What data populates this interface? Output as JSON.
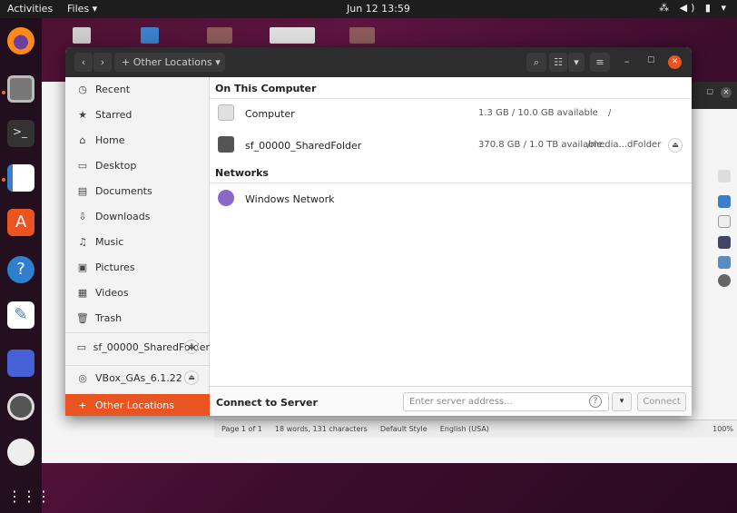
{
  "topbar": {
    "activities": "Activities",
    "app_menu": "Files ▾",
    "clock": "Jun 12  13:59",
    "tray": "⁂ ◀) ▮ ▾"
  },
  "files_window": {
    "location_button": "Other Locations",
    "sidebar": [
      {
        "icon": "recent-icon",
        "glyph": "◷",
        "label": "Recent"
      },
      {
        "icon": "star-icon",
        "glyph": "★",
        "label": "Starred"
      },
      {
        "icon": "home-icon",
        "glyph": "⌂",
        "label": "Home"
      },
      {
        "icon": "desktop-icon",
        "glyph": "▭",
        "label": "Desktop"
      },
      {
        "icon": "documents-icon",
        "glyph": "▤",
        "label": "Documents"
      },
      {
        "icon": "downloads-icon",
        "glyph": "⇩",
        "label": "Downloads"
      },
      {
        "icon": "music-icon",
        "glyph": "♫",
        "label": "Music"
      },
      {
        "icon": "pictures-icon",
        "glyph": "▣",
        "label": "Pictures"
      },
      {
        "icon": "videos-icon",
        "glyph": "▦",
        "label": "Videos"
      },
      {
        "icon": "trash-icon",
        "glyph": "🗑",
        "label": "Trash"
      }
    ],
    "devices": [
      {
        "label": "sf_00000_SharedFolder"
      },
      {
        "label": "VBox_GAs_6.1.22"
      }
    ],
    "other_locations": "Other Locations",
    "sections": {
      "on_this_computer": "On This Computer",
      "networks": "Networks"
    },
    "locations": [
      {
        "name": "Computer",
        "size": "1.3 GB / 10.0 GB available",
        "path": "/"
      },
      {
        "name": "sf_00000_SharedFolder",
        "size": "370.8 GB / 1.0 TB available",
        "path": "/media...dFolder"
      }
    ],
    "networks": [
      {
        "name": "Windows Network"
      }
    ],
    "connect": {
      "label": "Connect to Server",
      "placeholder": "Enter server address...",
      "button": "Connect"
    }
  },
  "background_writer": {
    "status": {
      "page": "Page 1 of 1",
      "words": "18 words, 131 characters",
      "style": "Default Style",
      "language": "English (USA)",
      "zoom": "100%"
    }
  },
  "colors": {
    "accent": "#e95420",
    "titlebar": "#2d2d2d",
    "topbar": "#1d1d1d"
  }
}
